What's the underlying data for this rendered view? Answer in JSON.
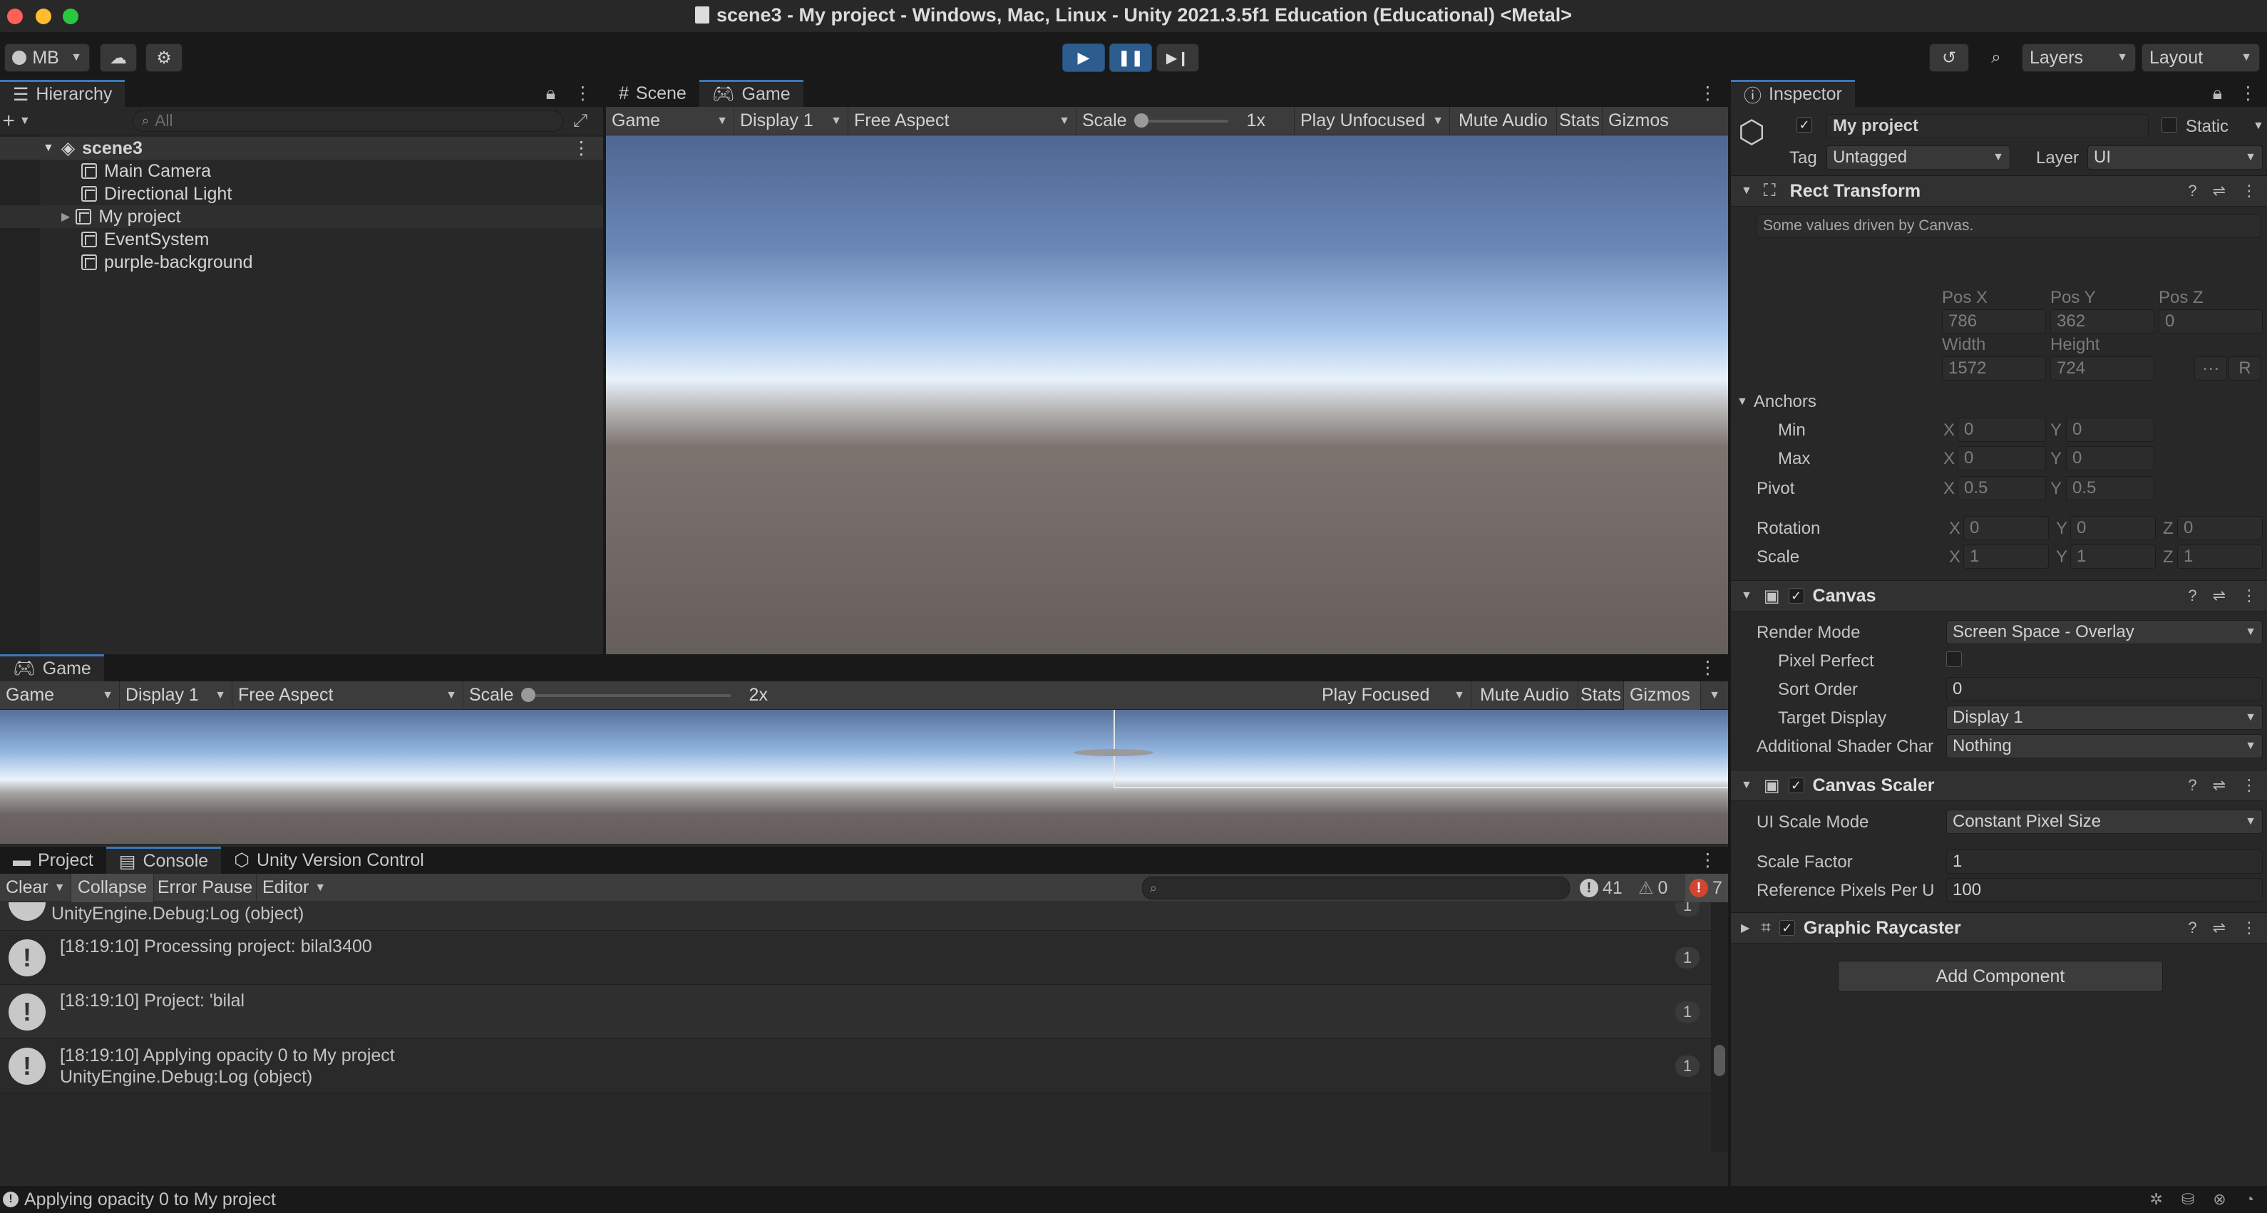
{
  "window": {
    "title": "scene3 - My project - Windows, Mac, Linux - Unity 2021.3.5f1 Education (Educational) <Metal>"
  },
  "toolbar": {
    "account": "MB",
    "layers": "Layers",
    "layout": "Layout"
  },
  "hierarchy": {
    "tab": "Hierarchy",
    "search_placeholder": "All",
    "scene": "scene3",
    "items": [
      "Main Camera",
      "Directional Light",
      "My project",
      "EventSystem",
      "purple-background"
    ]
  },
  "scene_view": {
    "tabs": [
      "Scene",
      "Game"
    ],
    "game_dropdown": "Game",
    "display": "Display 1",
    "aspect": "Free Aspect",
    "scale_label": "Scale",
    "scale_value": "1x",
    "play_mode": "Play Unfocused",
    "mute": "Mute Audio",
    "stats": "Stats",
    "gizmos": "Gizmos"
  },
  "game_view": {
    "tab": "Game",
    "game_dropdown": "Game",
    "display": "Display 1",
    "aspect": "Free Aspect",
    "scale_label": "Scale",
    "scale_value": "2x",
    "play_mode": "Play Focused",
    "mute": "Mute Audio",
    "stats": "Stats",
    "gizmos": "Gizmos"
  },
  "console": {
    "tabs": [
      "Project",
      "Console",
      "Unity Version Control"
    ],
    "clear": "Clear",
    "collapse": "Collapse",
    "error_pause": "Error Pause",
    "editor": "Editor",
    "count_info": "41",
    "count_warn": "0",
    "count_error": "7",
    "top_partial": "UnityEngine.Debug:Log (object)",
    "top_partial_count": "1",
    "logs": [
      {
        "line1": "[18:19:10] Processing project: bilal3400",
        "line2": "",
        "count": "1"
      },
      {
        "line1": "[18:19:10] Project: 'bilal",
        "line2": "",
        "count": "1"
      },
      {
        "line1": "[18:19:10] Applying opacity 0 to My project",
        "line2": "UnityEngine.Debug:Log (object)",
        "count": "1"
      }
    ]
  },
  "status_bar": {
    "text": "Applying opacity 0 to My project"
  },
  "inspector": {
    "tab": "Inspector",
    "object_name": "My project",
    "static_label": "Static",
    "tag_label": "Tag",
    "tag_value": "Untagged",
    "layer_label": "Layer",
    "layer_value": "UI",
    "rect_transform": {
      "title": "Rect Transform",
      "note": "Some values driven by Canvas.",
      "pos_x_label": "Pos X",
      "pos_y_label": "Pos Y",
      "pos_z_label": "Pos Z",
      "pos_x": "786",
      "pos_y": "362",
      "pos_z": "0",
      "width_label": "Width",
      "height_label": "Height",
      "width": "1572",
      "height": "724",
      "r_button": "R",
      "anchors_label": "Anchors",
      "min_label": "Min",
      "max_label": "Max",
      "pivot_label": "Pivot",
      "min_x": "0",
      "min_y": "0",
      "max_x": "0",
      "max_y": "0",
      "pivot_x": "0.5",
      "pivot_y": "0.5",
      "rotation_label": "Rotation",
      "scale_label": "Scale",
      "rot_x": "0",
      "rot_y": "0",
      "rot_z": "0",
      "scale_x": "1",
      "scale_y": "1",
      "scale_z": "1",
      "x": "X",
      "y": "Y",
      "z": "Z"
    },
    "canvas": {
      "title": "Canvas",
      "render_mode_label": "Render Mode",
      "render_mode": "Screen Space - Overlay",
      "pixel_perfect_label": "Pixel Perfect",
      "sort_order_label": "Sort Order",
      "sort_order": "0",
      "target_display_label": "Target Display",
      "target_display": "Display 1",
      "shader_label": "Additional Shader Char",
      "shader": "Nothing"
    },
    "canvas_scaler": {
      "title": "Canvas Scaler",
      "ui_scale_label": "UI Scale Mode",
      "ui_scale": "Constant Pixel Size",
      "scale_factor_label": "Scale Factor",
      "scale_factor": "1",
      "ref_pixels_label": "Reference Pixels Per U",
      "ref_pixels": "100"
    },
    "graphic_raycaster": {
      "title": "Graphic Raycaster"
    },
    "add_component": "Add Component"
  },
  "colors": {
    "accent": "#3a79bb",
    "play_active": "#2d5d8e",
    "error": "#d2452f"
  }
}
